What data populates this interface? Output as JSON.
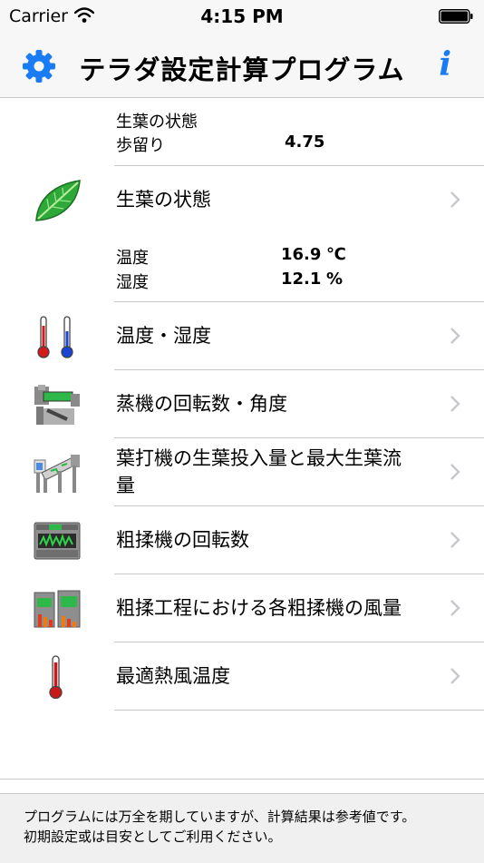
{
  "status_bar": {
    "carrier": "Carrier",
    "time": "4:15 PM"
  },
  "nav": {
    "title": "テラダ設定計算プログラム"
  },
  "summary_leaf": {
    "label1": "生葉の状態",
    "label2": "歩留り",
    "value2": "4.75"
  },
  "summary_env": {
    "temp_label": "温度",
    "temp_value": "16.9",
    "temp_unit": "℃",
    "hum_label": "湿度",
    "hum_value": "12.1",
    "hum_unit": "%"
  },
  "rows": [
    {
      "title": "生葉の状態",
      "icon": "leaf-icon"
    },
    {
      "title": "温度・湿度",
      "icon": "thermometers-icon"
    },
    {
      "title": "蒸機の回転数・角度",
      "icon": "steamer-machine-icon"
    },
    {
      "title": "葉打機の生葉投入量と最大生葉流量",
      "icon": "leaf-beater-machine-icon"
    },
    {
      "title": "粗揉機の回転数",
      "icon": "rough-roller-icon"
    },
    {
      "title": "粗揉工程における各粗揉機の風量",
      "icon": "airflow-bars-icon"
    },
    {
      "title": "最適熱風温度",
      "icon": "thermometer-icon"
    }
  ],
  "footer": {
    "line1": "プログラムには万全を期していますが、計算結果は参考値です。",
    "line2": "初期設定或は目安としてご利用ください。"
  },
  "colors": {
    "accent": "#1a7cf5",
    "separator": "#c8c7cc",
    "chevron": "#c7c7cc"
  }
}
